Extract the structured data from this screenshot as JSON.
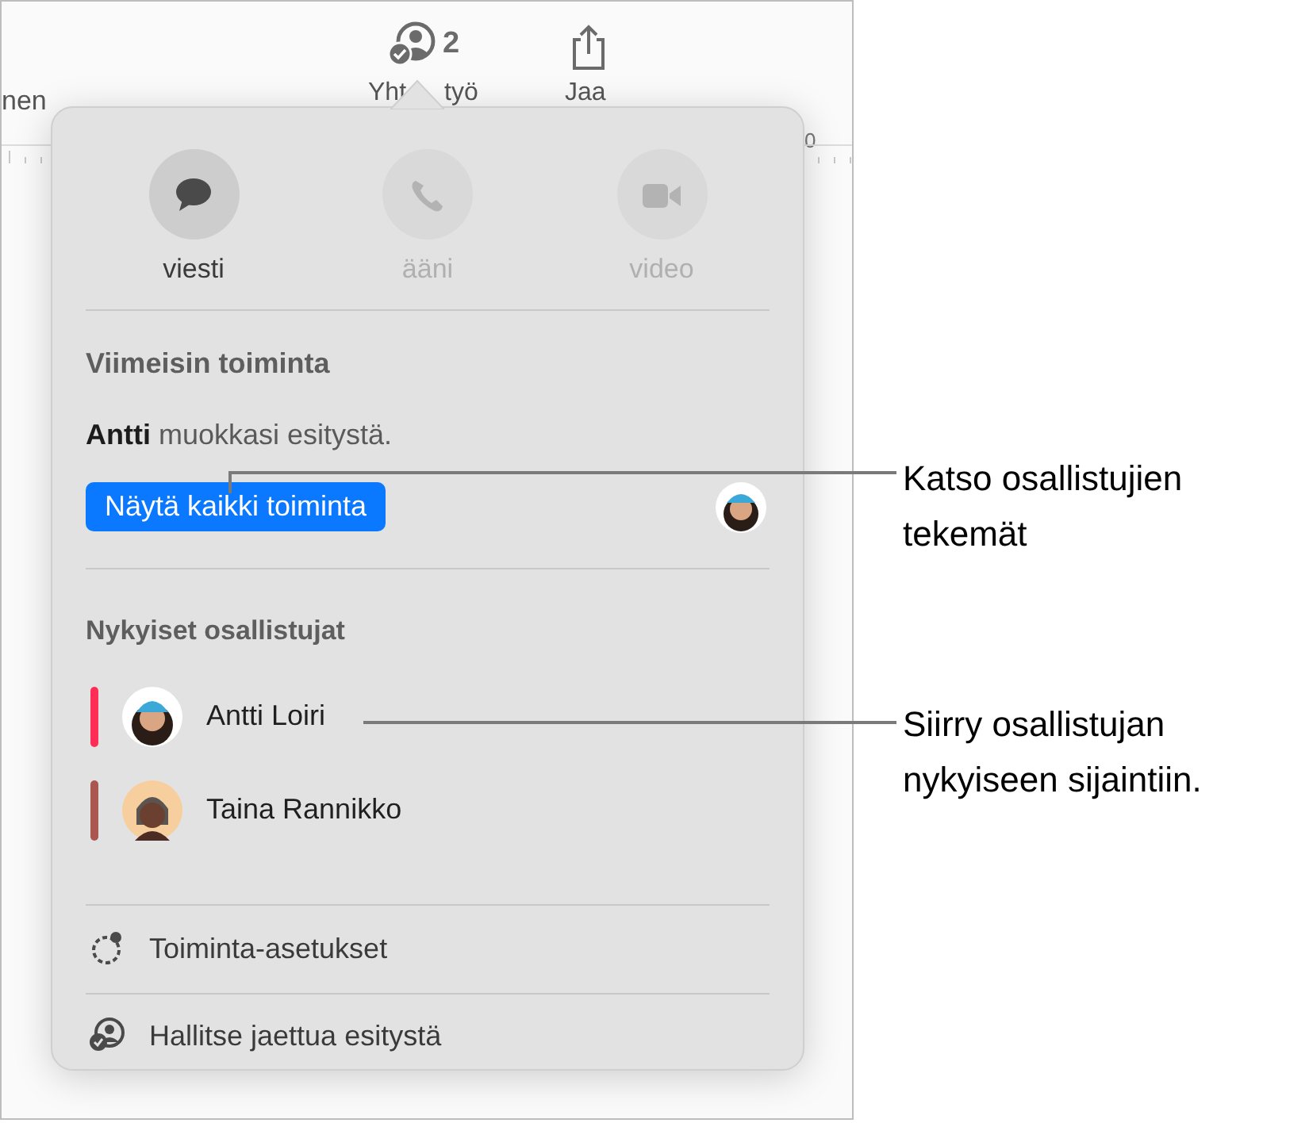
{
  "toolbar": {
    "left_label": "nen",
    "collaborate": {
      "label_parts": [
        "Yht",
        "työ"
      ],
      "count": "2"
    },
    "share": {
      "label": "Jaa"
    },
    "ruler_label": "0"
  },
  "popover": {
    "contact_buttons": [
      {
        "kind": "message",
        "label": "viesti",
        "disabled": false
      },
      {
        "kind": "phone",
        "label": "ääni",
        "disabled": true
      },
      {
        "kind": "video",
        "label": "video",
        "disabled": true
      }
    ],
    "recent_activity": {
      "heading": "Viimeisin toiminta",
      "text": "**Antti** muokkasi esitystä.",
      "button": "Näytä kaikki toiminta"
    },
    "participants": {
      "heading": "Nykyiset osallistujat",
      "items": [
        {
          "name": "Antti Loiri",
          "color": "#ff2d55",
          "kind": "light"
        },
        {
          "name": "Taina Rannikko",
          "color": "#a9574f",
          "kind": "dark"
        }
      ]
    },
    "menu": [
      {
        "kind": "settings",
        "label": "Toiminta-asetukset"
      },
      {
        "kind": "manage",
        "label": "Hallitse jaettua esitystä"
      }
    ]
  },
  "callouts": [
    {
      "text": "Katso osallistujien tekemät"
    },
    {
      "text": "Siirry osallistujan nykyiseen sijaintiin."
    }
  ]
}
